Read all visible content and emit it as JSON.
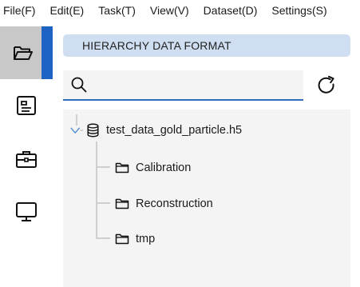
{
  "menu": {
    "items": [
      {
        "label": "File(F)"
      },
      {
        "label": "Edit(E)"
      },
      {
        "label": "Task(T)"
      },
      {
        "label": "View(V)"
      },
      {
        "label": "Dataset(D)"
      },
      {
        "label": "Settings(S)"
      }
    ]
  },
  "sidebar": {
    "items": [
      {
        "icon": "folder-open-icon",
        "active": true
      },
      {
        "icon": "id-card-icon",
        "active": false
      },
      {
        "icon": "toolbox-icon",
        "active": false
      },
      {
        "icon": "monitor-icon",
        "active": false
      }
    ]
  },
  "panel": {
    "title": "HIERARCHY DATA FORMAT"
  },
  "search": {
    "value": "",
    "placeholder": ""
  },
  "tree": {
    "root": {
      "label": "test_data_gold_particle.h5",
      "expanded": true
    },
    "children": [
      {
        "label": "Calibration"
      },
      {
        "label": "Reconstruction"
      },
      {
        "label": "tmp"
      }
    ]
  },
  "colors": {
    "accent": "#1e63c4",
    "title_bg": "#cfdff1",
    "active_bg": "#c8c8c8",
    "search_underline": "#2f6fba",
    "panel_bg": "#f4f4f4"
  }
}
